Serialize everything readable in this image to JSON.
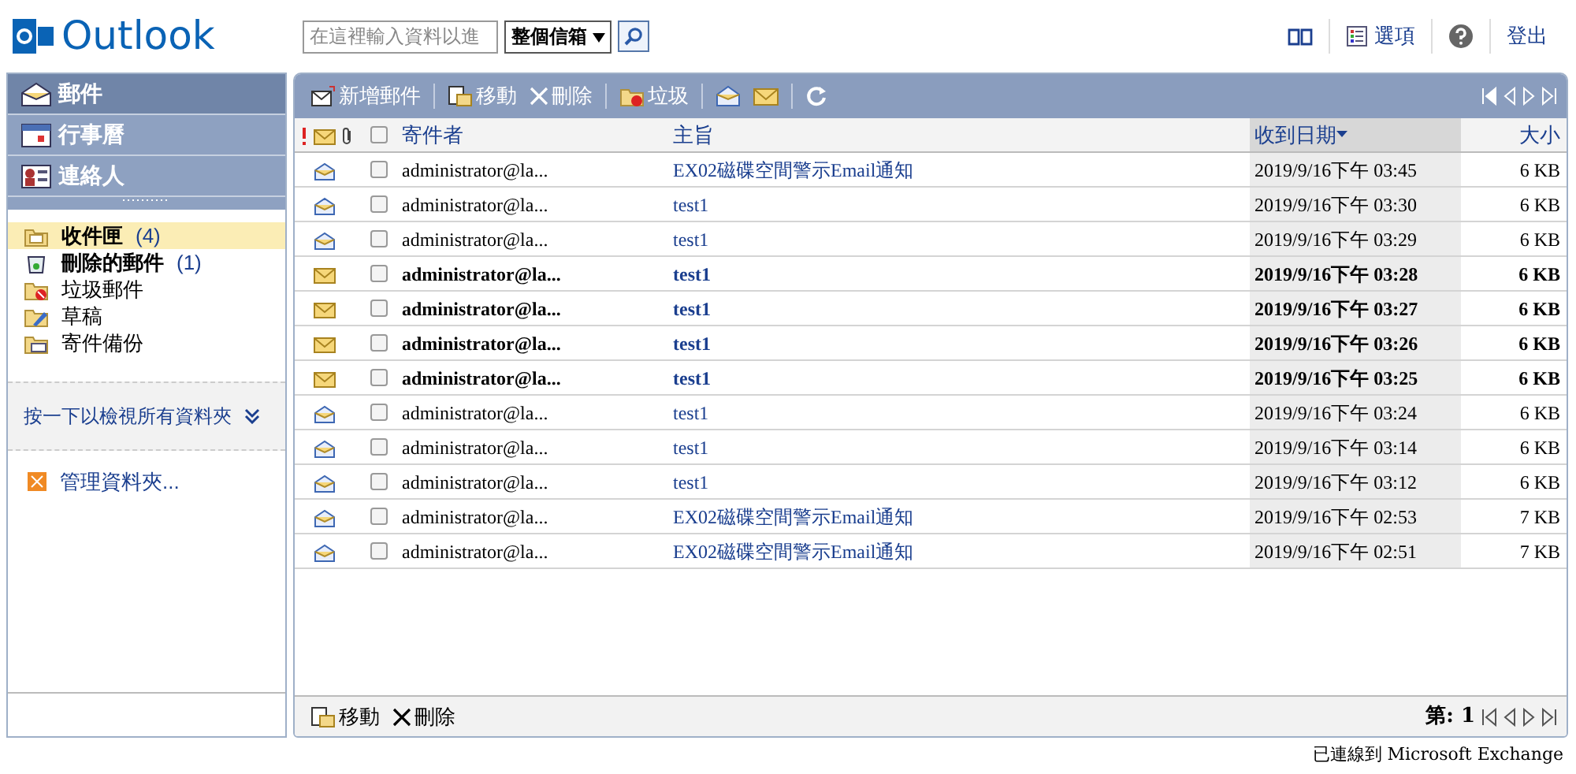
{
  "logo": {
    "text": "Outlook"
  },
  "search": {
    "placeholder": "在這裡輸入資料以進",
    "scope": "整個信箱"
  },
  "top_links": [
    {
      "kind": "address-book"
    },
    {
      "kind": "options",
      "label": "選項"
    },
    {
      "kind": "help"
    },
    {
      "kind": "signout",
      "label": "登出"
    }
  ],
  "nav": [
    {
      "label": "郵件",
      "kind": "mail",
      "selected": true
    },
    {
      "label": "行事曆",
      "kind": "calendar",
      "selected": false
    },
    {
      "label": "連絡人",
      "kind": "contacts",
      "selected": false
    }
  ],
  "folders": [
    {
      "label": "收件匣",
      "count": "(4)",
      "kind": "inbox",
      "selected": true
    },
    {
      "label": "刪除的郵件",
      "count": "(1)",
      "kind": "deleted",
      "selected": false
    },
    {
      "label": "垃圾郵件",
      "kind": "junk",
      "selected": false
    },
    {
      "label": "草稿",
      "kind": "drafts",
      "selected": false
    },
    {
      "label": "寄件備份",
      "kind": "sent",
      "selected": false
    }
  ],
  "all_folders_link": "按一下以檢視所有資料夾",
  "manage_folders": "管理資料夾...",
  "toolbar": [
    {
      "kind": "new",
      "label": "新增郵件"
    },
    {
      "kind": "move",
      "label": "移動"
    },
    {
      "kind": "delete",
      "label": "刪除"
    },
    {
      "kind": "junk",
      "label": "垃圾"
    },
    {
      "kind": "read"
    },
    {
      "kind": "unread"
    },
    {
      "kind": "refresh"
    }
  ],
  "select_all": {
    "checked": false
  },
  "columns": [
    {
      "label": "寄件者",
      "sorted": false
    },
    {
      "label": "主旨",
      "sorted": false
    },
    {
      "label": "收到日期",
      "sorted": true
    },
    {
      "label": "大小",
      "sorted": false
    }
  ],
  "rows": [
    {
      "sender": "administrator@la...",
      "subject": "EX02磁碟空間警示Email通知",
      "date": "2019/9/16下午 03:45",
      "size": "6 KB",
      "read": true,
      "checked": false
    },
    {
      "sender": "administrator@la...",
      "subject": "test1",
      "date": "2019/9/16下午 03:30",
      "size": "6 KB",
      "read": true,
      "checked": false
    },
    {
      "sender": "administrator@la...",
      "subject": "test1",
      "date": "2019/9/16下午 03:29",
      "size": "6 KB",
      "read": true,
      "checked": false
    },
    {
      "sender": "administrator@la...",
      "subject": "test1",
      "date": "2019/9/16下午 03:28",
      "size": "6 KB",
      "read": false,
      "checked": false
    },
    {
      "sender": "administrator@la...",
      "subject": "test1",
      "date": "2019/9/16下午 03:27",
      "size": "6 KB",
      "read": false,
      "checked": false
    },
    {
      "sender": "administrator@la...",
      "subject": "test1",
      "date": "2019/9/16下午 03:26",
      "size": "6 KB",
      "read": false,
      "checked": false
    },
    {
      "sender": "administrator@la...",
      "subject": "test1",
      "date": "2019/9/16下午 03:25",
      "size": "6 KB",
      "read": false,
      "checked": false
    },
    {
      "sender": "administrator@la...",
      "subject": "test1",
      "date": "2019/9/16下午 03:24",
      "size": "6 KB",
      "read": true,
      "checked": false
    },
    {
      "sender": "administrator@la...",
      "subject": "test1",
      "date": "2019/9/16下午 03:14",
      "size": "6 KB",
      "read": true,
      "checked": false
    },
    {
      "sender": "administrator@la...",
      "subject": "test1",
      "date": "2019/9/16下午 03:12",
      "size": "6 KB",
      "read": true,
      "checked": false
    },
    {
      "sender": "administrator@la...",
      "subject": "EX02磁碟空間警示Email通知",
      "date": "2019/9/16下午 02:53",
      "size": "7 KB",
      "read": true,
      "checked": false
    },
    {
      "sender": "administrator@la...",
      "subject": "EX02磁碟空間警示Email通知",
      "date": "2019/9/16下午 02:51",
      "size": "7 KB",
      "read": true,
      "checked": false
    }
  ],
  "bottom_toolbar": [
    {
      "kind": "move",
      "label": "移動"
    },
    {
      "kind": "delete",
      "label": "刪除"
    }
  ],
  "page_label": "第: 1",
  "status_bar": "已連線到 Microsoft Exchange"
}
